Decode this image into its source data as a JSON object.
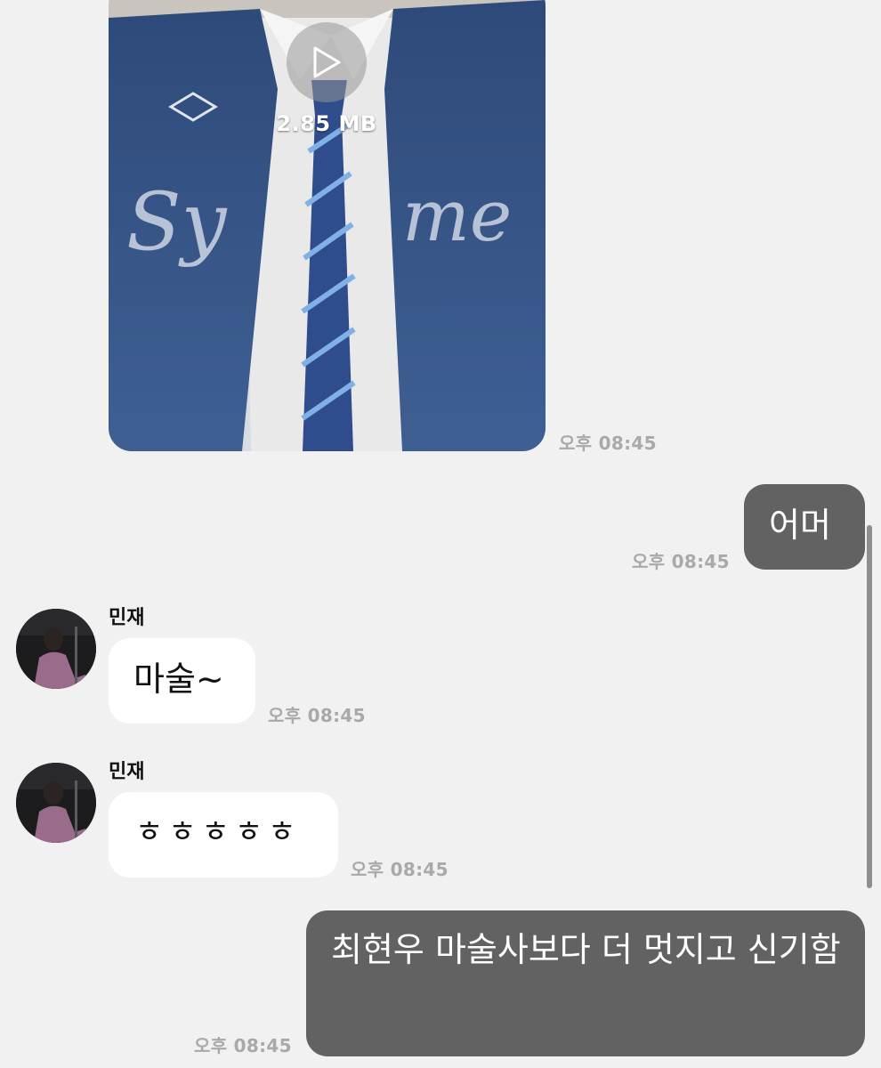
{
  "video_message": {
    "file_size": "2.85 MB",
    "time": "오후 08:45"
  },
  "messages": [
    {
      "direction": "out",
      "text": "어머",
      "time": "오후 08:45"
    },
    {
      "direction": "in",
      "sender": "민재",
      "text": "마술~",
      "time": "오후 08:45"
    },
    {
      "direction": "in",
      "sender": "민재",
      "text": "ㅎㅎㅎㅎㅎ",
      "time": "오후 08:45"
    },
    {
      "direction": "out",
      "text": "최현우 마술사보다 더 멋지고 신기함",
      "time": "오후 08:45"
    }
  ],
  "colors": {
    "background": "#f1f1f1",
    "outgoing_bubble": "#626262",
    "incoming_bubble": "#ffffff",
    "timestamp": "#a9a9a9"
  }
}
